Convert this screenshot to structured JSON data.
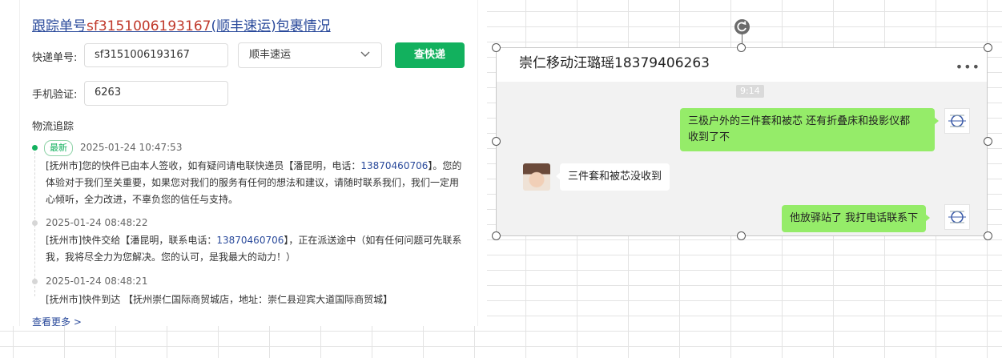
{
  "tracking": {
    "title_prefix": "跟踪单号",
    "title_number": "sf3151006193167",
    "title_carrier": "(顺丰速运)",
    "title_suffix": "包裹情况",
    "label_express_no": "快递单号:",
    "express_no_value": "sf3151006193167",
    "carrier_selected": "顺丰速运",
    "query_button": "查快递",
    "label_phone_verify": "手机验证:",
    "phone_verify_value": "6263",
    "section_title": "物流追踪",
    "latest_badge": "最新",
    "events": [
      {
        "time": "2025-01-24 10:47:53",
        "text_a": "[抚州市]您的快件已由本人签收，如有疑问请电联快递员【潘昆明，电话：",
        "phone": "13870460706",
        "text_b": "】。您的体验对于我们至关重要，如果您对我们的服务有任何的想法和建议，请随时联系我们，我们一定用心倾听，全力改进，不辜负您的信任与支持。"
      },
      {
        "time": "2025-01-24 08:48:22",
        "text_a": "[抚州市]快件交给【潘昆明，联系电话：",
        "phone": "13870460706",
        "text_b": "】，正在派送途中（如有任何问题可先联系我，我将尽全力为您解决。您的认可，是我最大的动力！）"
      },
      {
        "time": "2025-01-24 08:48:21",
        "text_a": "[抚州市]快件到达 【抚州崇仁国际商贸城店，地址：崇仁县迎宾大道国际商贸城】"
      }
    ],
    "view_more": "查看更多 >"
  },
  "chat": {
    "contact_name": "崇仁移动汪璐瑶18379406263",
    "more_icon": "more-dots-icon",
    "time_badge": "9:14",
    "messages": [
      {
        "from": "self",
        "text_line1": "三极户外的三件套和被芯 还有折叠床和投影仪都",
        "text_line2": "收到了不"
      },
      {
        "from": "other",
        "text": "三件套和被芯没收到"
      },
      {
        "from": "self",
        "text": "他放驿站了 我打电话联系下"
      }
    ]
  },
  "colors": {
    "accent_green": "#12b15e",
    "link_blue": "#2a4a9b",
    "tracking_red": "#c0392b",
    "chat_bubble_green": "#95ec69"
  }
}
